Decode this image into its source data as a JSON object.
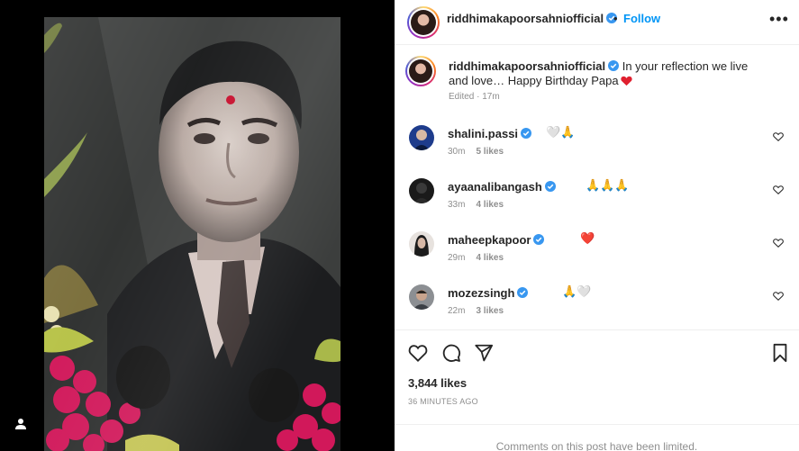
{
  "post": {
    "username": "riddhimakapoorsahniofficial",
    "separator": "•",
    "follow_label": "Follow",
    "more_label": "•••"
  },
  "caption": {
    "username": "riddhimakapoorsahniofficial",
    "text": "In your reflection we live and love… Happy Birthday Papa",
    "emoji": "red-heart",
    "edited": "Edited · 17m"
  },
  "comments": [
    {
      "username": "shalini.passi",
      "text": "🤍🙏",
      "time": "30m",
      "likes": "5 likes"
    },
    {
      "username": "ayaanalibangash",
      "text": "🙏🙏🙏",
      "time": "33m",
      "likes": "4 likes"
    },
    {
      "username": "maheepkapoor",
      "text": "❤️",
      "time": "29m",
      "likes": "4 likes"
    },
    {
      "username": "mozezsingh",
      "text": "🙏🤍",
      "time": "22m",
      "likes": "3 likes"
    }
  ],
  "stats": {
    "likes": "3,844 likes",
    "time_ago": "36 MINUTES AGO"
  },
  "footer": {
    "limited": "Comments on this post have been limited."
  },
  "colors": {
    "follow": "#0095f6",
    "verified": "#3897f0",
    "muted": "#8e8e8e",
    "heart": "#ed4956"
  }
}
